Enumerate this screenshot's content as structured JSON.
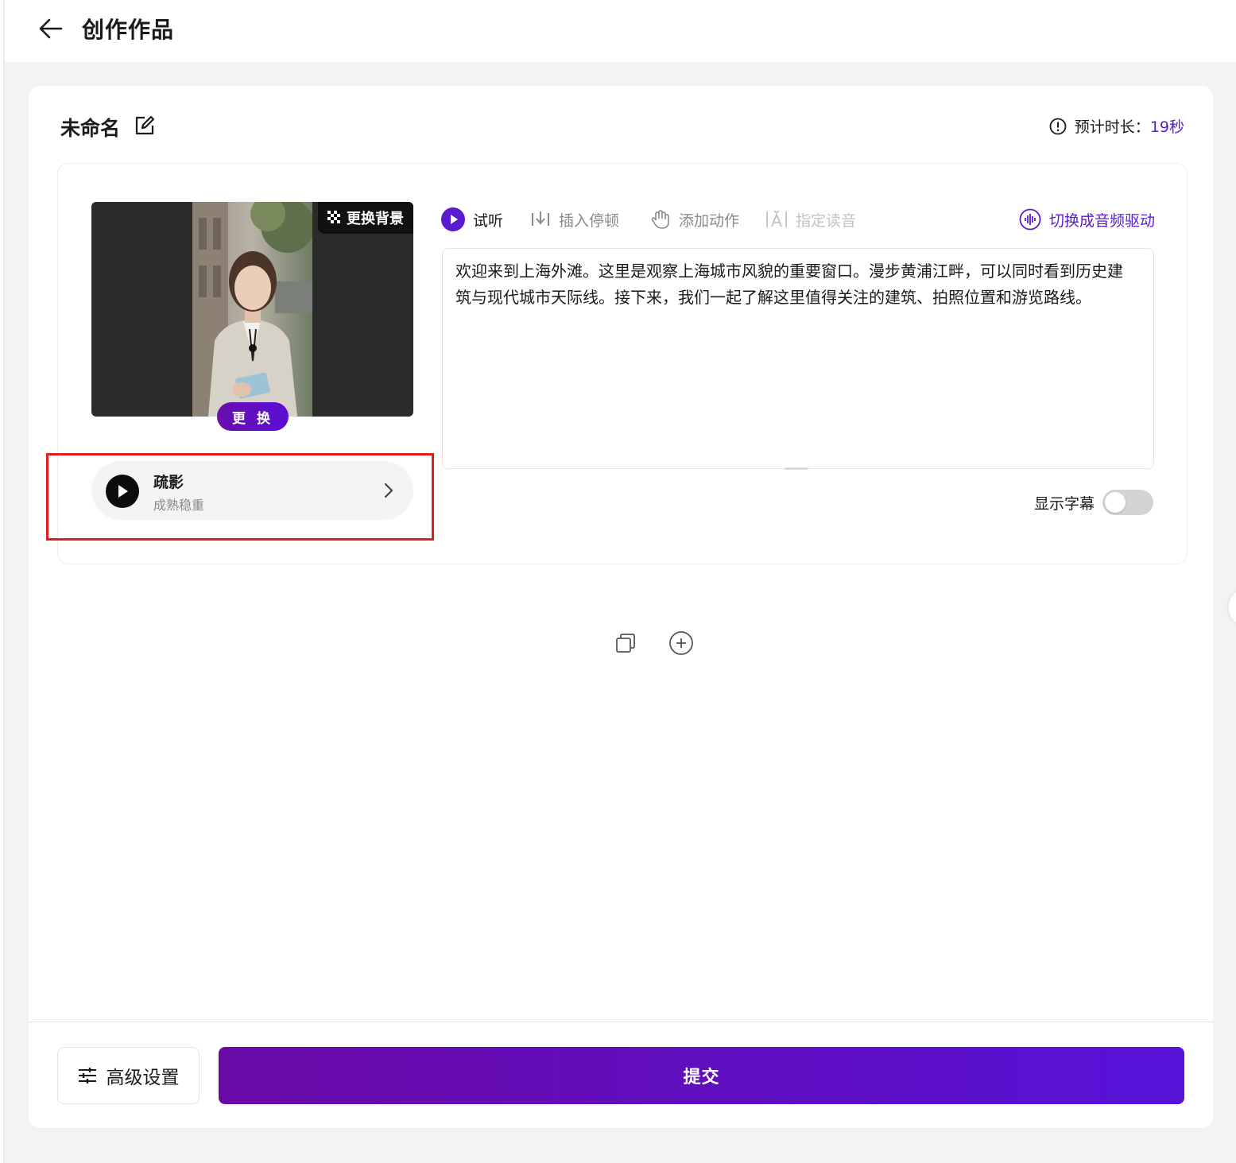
{
  "header": {
    "title": "创作作品"
  },
  "work": {
    "name": "未命名",
    "duration_label": "预计时长：",
    "duration_value": "19秒"
  },
  "avatar": {
    "change_bg_label": "更换背景",
    "change_label": "更 换"
  },
  "voice": {
    "name": "疏影",
    "style": "成熟稳重"
  },
  "toolbar": {
    "listen": "试听",
    "insert_pause": "插入停顿",
    "add_action": "添加动作",
    "pronunciation": "指定读音",
    "switch_audio": "切换成音频驱动"
  },
  "script": {
    "text": "欢迎来到上海外滩。这里是观察上海城市风貌的重要窗口。漫步黄浦江畔，可以同时看到历史建筑与现代城市天际线。接下来，我们一起了解这里值得关注的建筑、拍照位置和游览路线。"
  },
  "subtitle": {
    "label": "显示字幕",
    "enabled": false
  },
  "footer": {
    "advanced_label": "高级设置",
    "submit_label": "提交"
  },
  "colors": {
    "accent": "#5b1bd1",
    "highlight": "#e02020"
  }
}
